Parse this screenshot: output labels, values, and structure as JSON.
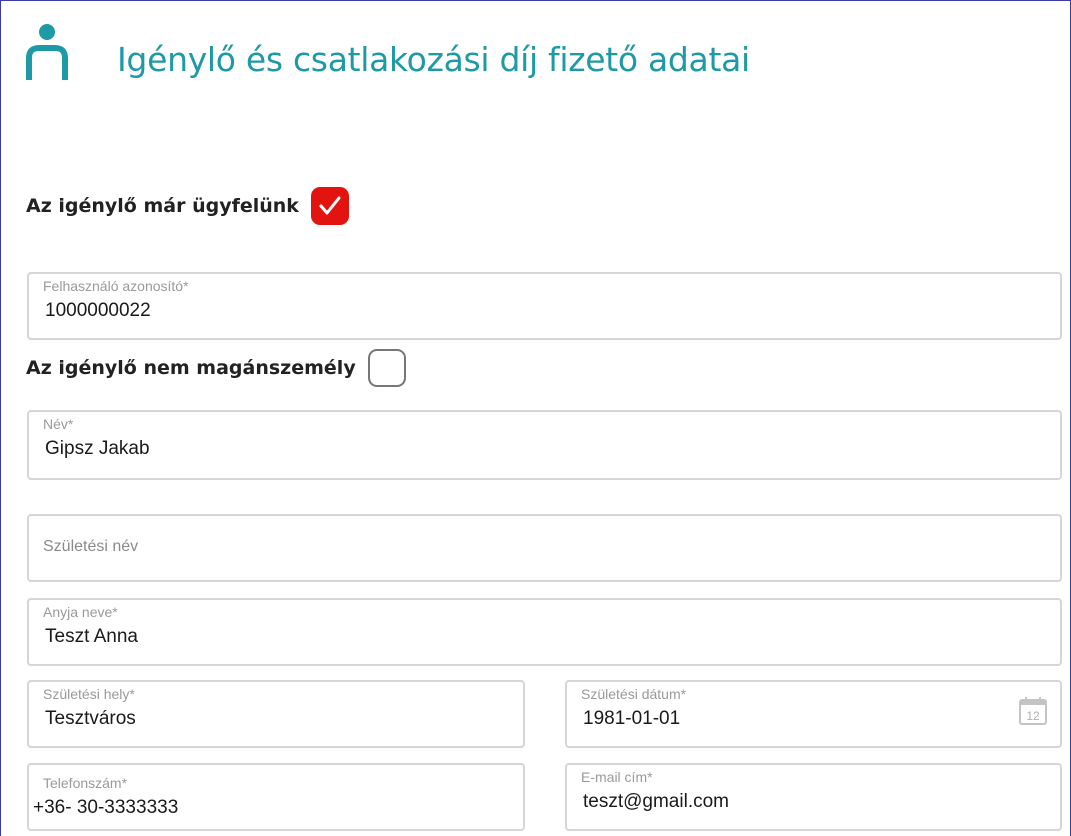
{
  "header": {
    "title": "Igénylő és csatlakozási díj fizető adatai",
    "icon": "person-icon",
    "accent_color": "#1d9aa6"
  },
  "existing_customer": {
    "label": "Az igénylő már ügyfelünk",
    "checked": true
  },
  "user_id": {
    "label": "Felhasználó azonosító*",
    "value": "1000000022"
  },
  "not_private_person": {
    "label": "Az igénylő nem magánszemély",
    "checked": false
  },
  "name": {
    "label": "Név*",
    "value": "Gipsz Jakab"
  },
  "birth_name": {
    "placeholder": "Születési név",
    "value": ""
  },
  "mother_name": {
    "label": "Anyja neve*",
    "value": "Teszt Anna"
  },
  "birth_place": {
    "label": "Születési hely*",
    "value": "Tesztváros"
  },
  "birth_date": {
    "label": "Születési dátum*",
    "value": "1981-01-01",
    "calendar_day": "12"
  },
  "phone": {
    "label": "Telefonszám*",
    "value": "+36- 30-3333333"
  },
  "email": {
    "label": "E-mail cím*",
    "value": "teszt@gmail.com"
  },
  "colors": {
    "checkbox_checked": "#e3140f",
    "field_border": "#d6d6d6"
  }
}
